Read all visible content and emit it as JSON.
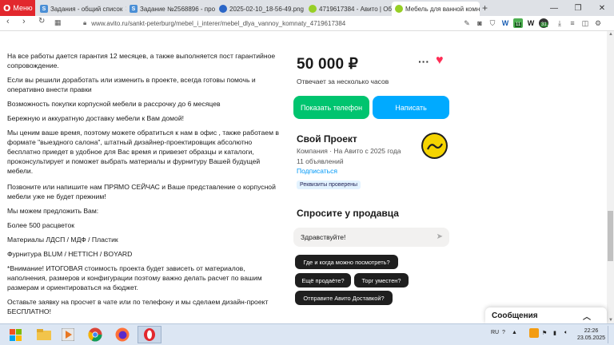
{
  "browser": {
    "menu_label": "Меню",
    "tabs": [
      {
        "label": "Задания - общий список",
        "icon": "sp-icon"
      },
      {
        "label": "Задание №2568896 - про",
        "icon": "sp-icon"
      },
      {
        "label": "2025-02-10_18-56-49.png",
        "icon": "image-icon"
      },
      {
        "label": "4719617384 - Авито | Об",
        "icon": "avito-icon"
      },
      {
        "label": "Мебель для ванной комн",
        "icon": "avito-icon",
        "active": true
      }
    ],
    "new_tab": "+",
    "url": "www.avito.ru/sankt-peterburg/mebel_i_interer/mebel_dlya_vannoy_komnaty_4719617384",
    "badge_a": "11",
    "badge_b": "31"
  },
  "description": [
    "На все работы дается гарантия 12 месяцев, а также выполняется пост гарантийное сопровождение.",
    "Если вы решили доработать или изменить в проекте, всегда готовы помочь и оперативно внести правки",
    "Возможность покупки корпусной мебели в рассрочку до 6 месяцев",
    "Бережную и аккуратную доставку мебели к Вам домой!",
    "Мы ценим ваше время, поэтому можете обратиться к нам в офис , также работаем в формате \"выездного салона\", штатный дизайнер-проектировщик абсолютно бесплатно приедет в удобное для Вас время и привезет образцы и каталоги, проконсультирует и поможет выбрать материалы и фурнитуру Вашей будущей мебели.",
    "Позвоните или напишите нам ПРЯМО СЕЙЧАС и Ваше представление о корпусной мебели уже не будет прежним!",
    "Мы можем предложить Вам:",
    "Более 500 расцветок",
    "Материалы ЛДСП / МДФ / Пластик",
    "Фурнитура BLUM / HETTICH / BOYARD",
    "*Внимание! ИТОГОВАЯ стоимость проекта будет зависеть от материалов, наполнения, размеров и конфигурации поэтому важно делать расчет по вашим размерам и ориентироваться на бюджет.",
    "Оставьте заявку на просчет в чате или по телефону и мы сделаем дизайн-проект БЕСПЛАТНО!"
  ],
  "listing": {
    "price": "50 000 ₽",
    "reply_time": "Отвечает за несколько часов",
    "show_phone": "Показать телефон",
    "write": "Написать"
  },
  "seller": {
    "name": "Свой Проект",
    "type": "Компания · На Авито с 2025 года",
    "ads": "11 объявлений",
    "subscribe": "Подписаться",
    "verified": "Реквизиты проверены"
  },
  "ask": {
    "title": "Спросите у продавца",
    "input_value": "Здравствуйте!",
    "chips": [
      "Где и когда можно посмотреть?",
      "Ещё продаёте?",
      "Торг уместен?",
      "Отправите Авито Доставкой?"
    ]
  },
  "messages": {
    "label": "Сообщения"
  },
  "taskbar": {
    "lang": "RU",
    "time": "22:26",
    "date": "23.05.2025"
  },
  "colors": {
    "accent_green": "#00c46f",
    "accent_blue": "#00aaff",
    "heart": "#ff2d55",
    "opera_red": "#e2272d"
  }
}
